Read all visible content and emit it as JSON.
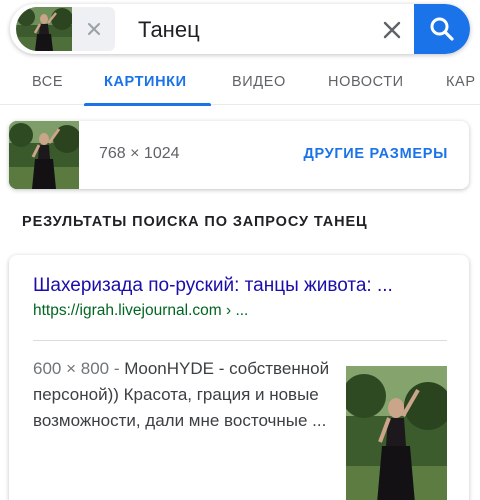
{
  "search": {
    "query": "Танец",
    "icons": {
      "clear": "close-icon",
      "search": "magnifier-icon",
      "chip_remove": "close-icon"
    }
  },
  "tabs": [
    {
      "label": "ВСЕ",
      "active": false
    },
    {
      "label": "КАРТИНКИ",
      "active": true
    },
    {
      "label": "ВИДЕО",
      "active": false
    },
    {
      "label": "НОВОСТИ",
      "active": false
    },
    {
      "label": "КАР",
      "active": false
    }
  ],
  "image_info": {
    "size": "768 × 1024",
    "other_sizes_label": "ДРУГИЕ РАЗМЕРЫ"
  },
  "results_heading": "РЕЗУЛЬТАТЫ ПОИСКА ПО ЗАПРОСУ ТАНЕЦ",
  "result": {
    "title": "Шахеризада по-руский: танцы живота: ...",
    "url": "https://igrah.livejournal.com › ...",
    "meta": "600 × 800 - ",
    "snippet": "MoonHYDE - собственной персоной)) Красота, грация и новые возможности, дали мне восточные ..."
  },
  "colors": {
    "accent": "#1a73e8",
    "link": "#1a0dab",
    "url": "#006621",
    "muted": "#5f6368"
  }
}
